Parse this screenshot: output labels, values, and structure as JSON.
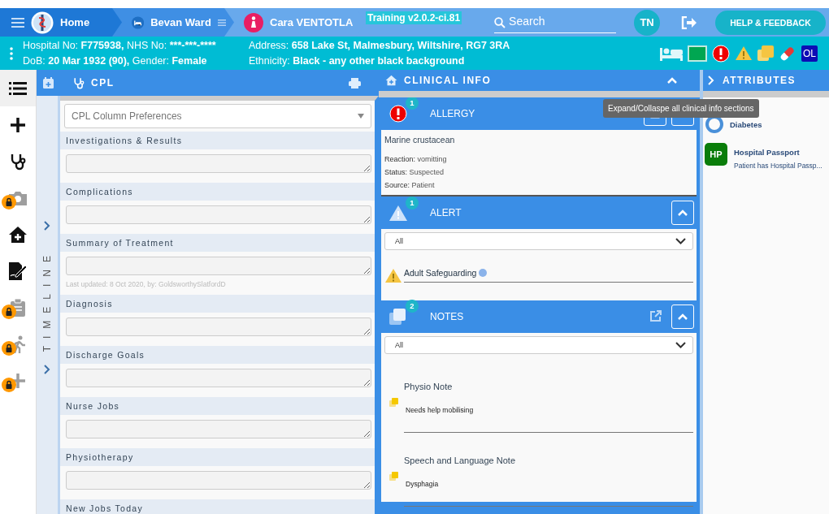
{
  "nav": {
    "home": "Home",
    "ward": "Bevan Ward",
    "patient": "Cara VENTOTLA",
    "version": "Training v2.0.2-ci.81",
    "search": {
      "placeholder": "Search"
    },
    "user": "TN",
    "help": "HELP & FEEDBACK"
  },
  "banner": {
    "lines": [
      [
        {
          "label": "Hospital No:",
          "value": "F775938,"
        },
        {
          "label": "NHS No:",
          "value": "***-***-****"
        }
      ],
      [
        {
          "label": "DoB:",
          "value": "20 Mar 1932 (90),"
        },
        {
          "label": "Gender:",
          "value": "Female"
        }
      ],
      [
        {
          "label": "Address:",
          "value": "658 Lake St, Malmesbury, Wiltshire, RG7 3RA"
        }
      ],
      [
        {
          "label": "Ethnicity:",
          "value": "Black - any other black background"
        }
      ]
    ],
    "flags": [
      {
        "kind": "bed"
      },
      {
        "kind": "green"
      },
      {
        "kind": "allergy"
      },
      {
        "kind": "warning"
      },
      {
        "kind": "notes"
      },
      {
        "kind": "pill"
      },
      {
        "kind": "text",
        "text": "OL"
      }
    ]
  },
  "rail": [
    {
      "kind": "list",
      "selected": true,
      "locked": false
    },
    {
      "kind": "plus",
      "selected": false,
      "locked": false
    },
    {
      "kind": "stethoscope",
      "selected": false,
      "locked": false
    },
    {
      "kind": "camera",
      "selected": false,
      "locked": true
    },
    {
      "kind": "home",
      "selected": false,
      "locked": false
    },
    {
      "kind": "sign",
      "selected": false,
      "locked": false
    },
    {
      "kind": "clipboard",
      "selected": false,
      "locked": true
    },
    {
      "kind": "walker",
      "selected": false,
      "locked": true
    },
    {
      "kind": "plus",
      "selected": false,
      "locked": true
    }
  ],
  "timeline": "TIMELINE",
  "cpl": {
    "title": "CPL",
    "preferences": {
      "placeholder": "CPL Column Preferences"
    },
    "sections": [
      {
        "label": "Investigations & Results"
      },
      {
        "label": "Complications"
      },
      {
        "label": "Summary of Treatment",
        "note": "Last updated: 8 Oct 2020, by: GoldsworthySlatfordD"
      },
      {
        "label": "Diagnosis"
      },
      {
        "label": "Discharge Goals"
      },
      {
        "label": "Nurse Jobs"
      },
      {
        "label": "Physiotherapy"
      },
      {
        "label": "New Jobs Today"
      }
    ]
  },
  "clinical": {
    "title": "CLINICAL INFO",
    "tooltip": "Expand/Collaspe all clinical info sections",
    "sections": [
      {
        "kind": "allergy",
        "title": "ALLERGY",
        "count": "1",
        "items": [
          {
            "name": "Marine crustacean",
            "details": [
              {
                "label": "Reaction:",
                "value": "vomitting"
              },
              {
                "label": "Status:",
                "value": "Suspected"
              },
              {
                "label": "Source:",
                "value": "Patient"
              }
            ]
          }
        ]
      },
      {
        "kind": "alert",
        "title": "ALERT",
        "count": "1",
        "filter": "All",
        "items": [
          {
            "text": "Adult Safeguarding"
          }
        ]
      },
      {
        "kind": "notes",
        "title": "NOTES",
        "count": "2",
        "filter": "All",
        "items": [
          {
            "title": "Physio Note",
            "body": "Needs help mobilising"
          },
          {
            "title": "Speech and Language Note",
            "body": "Dysphagia"
          }
        ]
      }
    ]
  },
  "attributes": {
    "title": "ATTRIBUTES",
    "items": [
      {
        "kind": "ring",
        "title": "Diabetes"
      },
      {
        "kind": "badge",
        "badge": "HP",
        "title": "Hospital Passport",
        "subtitle": "Patient has Hospital Passp..."
      }
    ]
  }
}
